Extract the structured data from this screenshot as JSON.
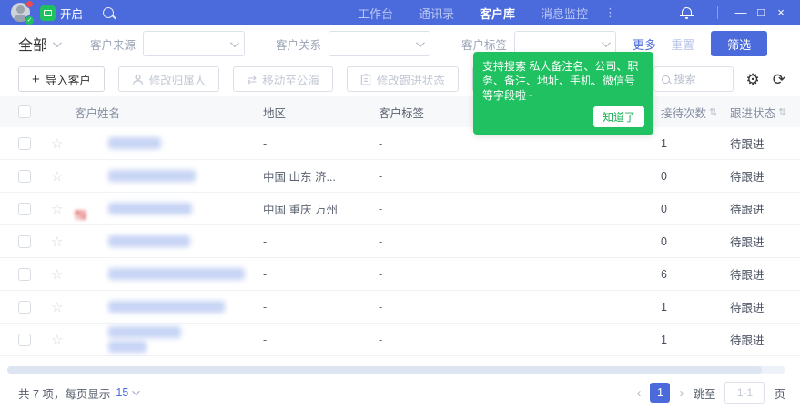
{
  "colors": {
    "accent": "#4b6bdc",
    "tooltip_green": "#1fc161",
    "header_bg": "#f7f8fa"
  },
  "titlebar": {
    "record_label": "开启",
    "tabs": [
      {
        "label": "工作台",
        "active": false
      },
      {
        "label": "通讯录",
        "active": false
      },
      {
        "label": "客户库",
        "active": true
      },
      {
        "label": "消息监控",
        "active": false
      }
    ],
    "more_glyph": "⋮",
    "window_controls": {
      "minimize": "—",
      "maximize": "□",
      "close": "×"
    }
  },
  "filters": {
    "scope": "全部",
    "fields": [
      {
        "label": "客户来源",
        "value": ""
      },
      {
        "label": "客户关系",
        "value": ""
      },
      {
        "label": "客户标签",
        "value": ""
      }
    ],
    "more": "更多",
    "reset": "重置",
    "filter_button": "筛选"
  },
  "toolbar": {
    "import_button": "导入客户",
    "plus_glyph": "+",
    "disabled_buttons": [
      "修改归属人",
      "移动至公海",
      "修改跟进状态"
    ],
    "search_placeholder": "搜索",
    "gear_glyph": "⚙",
    "refresh_glyph": "⟳"
  },
  "tooltip": {
    "text": "支持搜索 私人备注名、公司、职务、备注、地址、手机、微信号 等字段啦~",
    "confirm_button": "知道了"
  },
  "table": {
    "headers": {
      "name": "客户姓名",
      "region": "地区",
      "tag": "客户标签",
      "count": "接待次数",
      "status": "跟进状态",
      "sorter": "⇅"
    },
    "rows": [
      {
        "region": "-",
        "tag": "-",
        "count": "1",
        "status": "待跟进",
        "name_w": 58,
        "name_w2": 0,
        "shape": "square",
        "colors": [
          "#7a5148",
          "#93402f",
          "#4a3b3a",
          "#b59a8c"
        ]
      },
      {
        "region": "中国 山东 济...",
        "tag": "-",
        "count": "0",
        "status": "待跟进",
        "name_w": 96,
        "name_w2": 0,
        "shape": "square",
        "colors": [
          "#5b9bd5",
          "#7ec0e8",
          "#53b96a",
          "#e8a0a0"
        ]
      },
      {
        "region": "中国 重庆 万州",
        "tag": "-",
        "count": "0",
        "status": "待跟进",
        "name_w": 92,
        "name_w2": 0,
        "shape": "small",
        "colors": [
          "#f2b0b0",
          "#eaa0a0",
          "#f5caca",
          "#e89898"
        ]
      },
      {
        "region": "-",
        "tag": "-",
        "count": "0",
        "status": "待跟进",
        "name_w": 90,
        "name_w2": 0,
        "shape": "round",
        "colors": [
          "#6a4f9e",
          "#553d8a",
          "#7a5fae",
          "#4a3680"
        ]
      },
      {
        "region": "-",
        "tag": "-",
        "count": "6",
        "status": "待跟进",
        "name_w": 150,
        "name_w2": 0,
        "shape": "round",
        "colors": [
          "#d84d2c",
          "#c25a32",
          "#b8502f",
          "#d06038"
        ]
      },
      {
        "region": "-",
        "tag": "-",
        "count": "1",
        "status": "待跟进",
        "name_w": 128,
        "name_w2": 0,
        "shape": "square",
        "colors": [
          "#9aa0a6",
          "#b8b4a8",
          "#e07b3a",
          "#3aa870"
        ]
      },
      {
        "region": "-",
        "tag": "-",
        "count": "1",
        "status": "待跟进",
        "name_w": 80,
        "name_w2": 42,
        "shape": "square",
        "colors": [
          "#8a8f96",
          "#6a6f76",
          "#5a4a42",
          "#9aa0a8"
        ]
      }
    ]
  },
  "footer": {
    "total_text": "共 7 项，每页显示",
    "page_size": "15",
    "prev_glyph": "‹",
    "current_page": "1",
    "next_glyph": "›",
    "jump_label": "跳至",
    "jump_placeholder": "1-1",
    "page_suffix": "页"
  }
}
